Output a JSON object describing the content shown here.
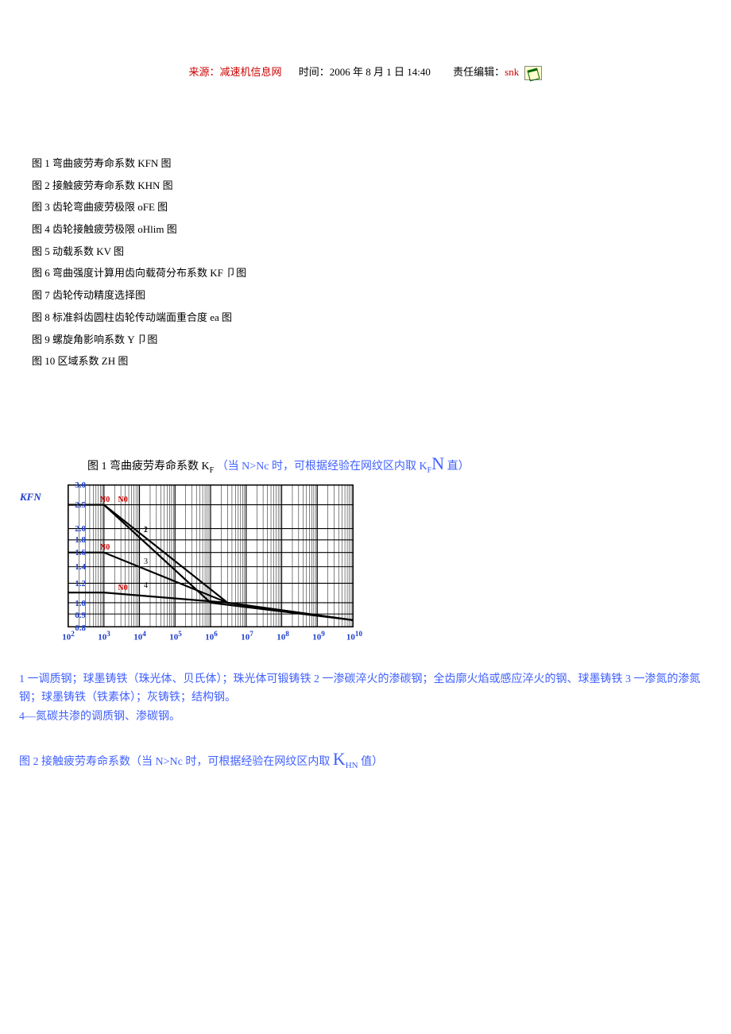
{
  "header": {
    "source": "来源：减速机信息网",
    "time": "时间：2006 年 8 月 1 日 14:40",
    "editor_label": "责任编辑：",
    "editor_name": "snk"
  },
  "toc": {
    "items": [
      "图 1 弯曲疲劳寿命系数 KFN 图",
      "图 2 接触疲劳寿命系数 KHN 图",
      "图 3 齿轮弯曲疲劳极限 oFE 图",
      "图 4 齿轮接触疲劳极限 oHlim 图",
      "图 5 动载系数 KV 图",
      "图 6 弯曲强度计算用齿向载荷分布系数 KF 卩图",
      "图 7 齿轮传动精度选择图",
      "图 8 标准斜齿圆柱齿轮传动端面重合度 ea 图",
      "图 9 螺旋角影响系数 Y 卩图",
      "图 10 区域系数 ZH 图"
    ]
  },
  "fig1": {
    "pre": "图 1 弯曲疲劳寿命系数 K",
    "sub1": "F",
    "mid": "（当 N>Nc 时，可根据经验在网纹区内取 K",
    "sub2": "F",
    "bigN": "N",
    "tail": " 直）"
  },
  "chart_data": {
    "type": "line",
    "ylabel": "KFN",
    "y_ticks": [
      3.0,
      2.5,
      2.0,
      1.8,
      1.6,
      1.4,
      1.2,
      1.0,
      0.9,
      0.8
    ],
    "x_ticks_exp": [
      2,
      3,
      4,
      5,
      6,
      7,
      8,
      9,
      10
    ],
    "xlabel_base": "10",
    "series": [
      {
        "name": "1",
        "points": [
          [
            2.0,
            2.5
          ],
          [
            3.0,
            2.5
          ],
          [
            6.48,
            1.0
          ],
          [
            10.0,
            0.85
          ]
        ]
      },
      {
        "name": "2",
        "points": [
          [
            2.0,
            2.5
          ],
          [
            3.0,
            2.5
          ],
          [
            6.0,
            1.0
          ],
          [
            10.0,
            0.85
          ]
        ]
      },
      {
        "name": "3",
        "points": [
          [
            2.0,
            1.6
          ],
          [
            3.0,
            1.6
          ],
          [
            6.48,
            1.0
          ],
          [
            10.0,
            0.85
          ]
        ]
      },
      {
        "name": "4",
        "points": [
          [
            2.0,
            1.1
          ],
          [
            3.0,
            1.1
          ],
          [
            6.48,
            1.0
          ],
          [
            10.0,
            0.85
          ]
        ]
      }
    ],
    "red_marks": [
      {
        "label": "N0",
        "x": 3.0,
        "y": 2.5
      },
      {
        "label": "N0",
        "x": 3.5,
        "y": 2.5
      },
      {
        "label": "N0",
        "x": 3.0,
        "y": 1.6
      },
      {
        "label": "N0",
        "x": 3.5,
        "y": 1.1
      }
    ]
  },
  "caption": {
    "text": "1 一调质钢；球墨铸铁（珠光体、贝氏体）；珠光体可锻铸铁  2 一渗碳淬火的渗碳钢；全齿廓火焰或感应淬火的钢、球墨铸铁  3 一渗氮的渗氮钢；球墨铸铁（铁素体）；灰铸铁；结构钢。\n4—氮碳共渗的调质钢、渗碳钢。"
  },
  "fig2": {
    "pre": "图 2 接触疲劳寿命系数（当 N>Nc 时，可根据经验在网纹区内取 ",
    "k": "K",
    "sub": "HN",
    "tail": " 值）"
  }
}
